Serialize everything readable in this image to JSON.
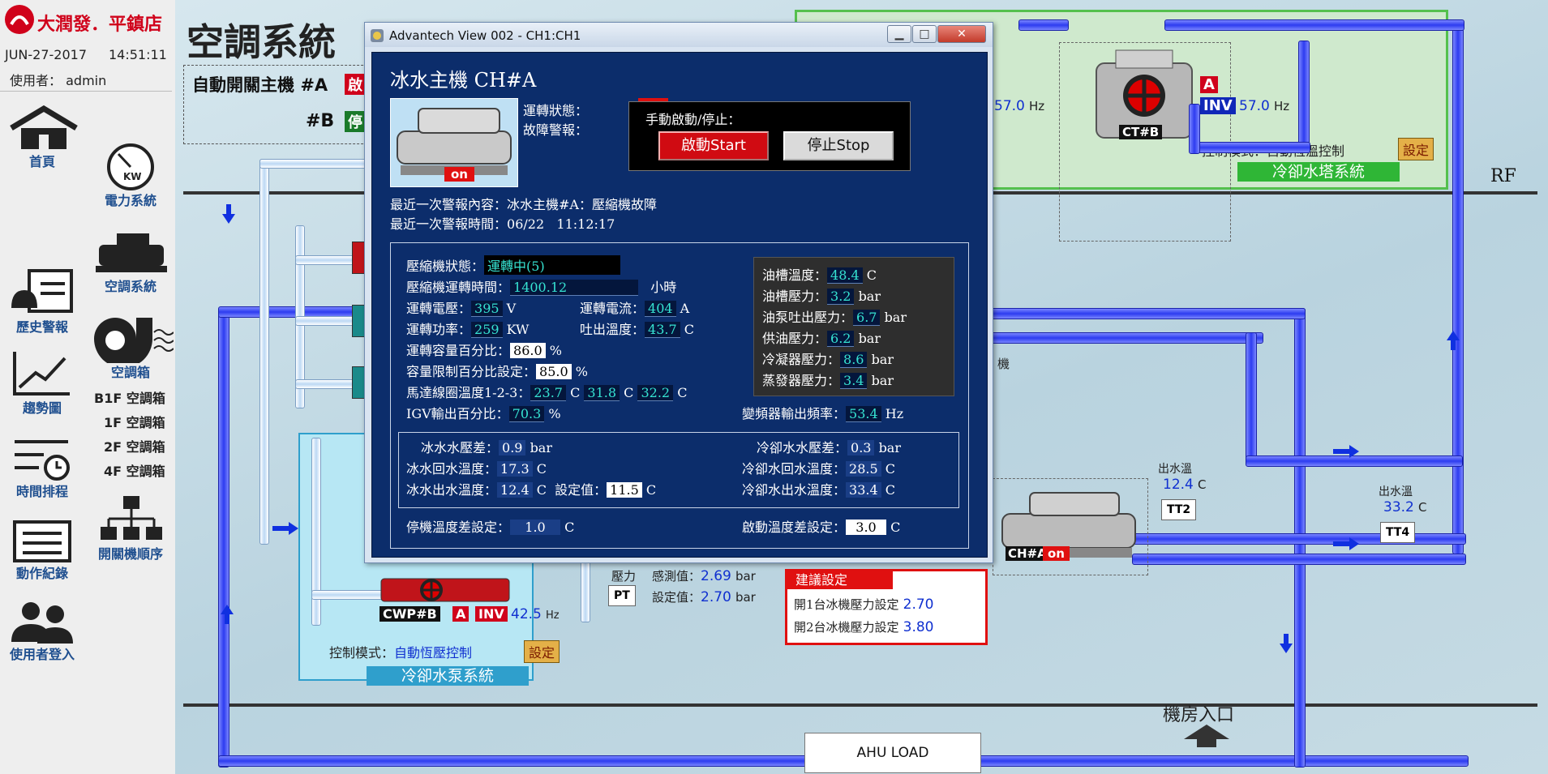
{
  "brand": {
    "name": "大潤發．平鎮店"
  },
  "header": {
    "date": "JUN-27-2017",
    "time": "14:51:11",
    "user_label": "使用者：",
    "user": "admin",
    "page_title": "空調系統"
  },
  "nav_left": [
    {
      "label": "首頁",
      "icon": "home-icon"
    },
    {
      "label": "歷史警報",
      "icon": "alarm-history-icon"
    },
    {
      "label": "趨勢圖",
      "icon": "trend-chart-icon"
    },
    {
      "label": "時間排程",
      "icon": "schedule-icon"
    },
    {
      "label": "動作紀錄",
      "icon": "action-log-icon"
    },
    {
      "label": "使用者登入",
      "icon": "users-icon"
    }
  ],
  "nav_right": [
    {
      "label": "電力系統",
      "icon": "power-meter-icon"
    },
    {
      "label": "空調系統",
      "icon": "chiller-icon"
    },
    {
      "label": "空調箱",
      "icon": "ahu-fan-icon"
    }
  ],
  "ahu_sub": [
    "B1F 空調箱",
    "1F 空調箱",
    "2F 空調箱",
    "4F 空調箱"
  ],
  "auto_switch": {
    "label": "自動開關主機",
    "a": "#A",
    "b": "#B",
    "a_btn": "啟",
    "b_btn": "停"
  },
  "cooling_tower": {
    "unit": "CT#B",
    "tag_a": "A",
    "tag_inv": "INV",
    "freq": "57.0",
    "freq_left": "57.0",
    "hz": "Hz",
    "mode_label": "控制模式：自動恆溫控制",
    "set_btn": "設定",
    "system_label": "冷卻水塔系統"
  },
  "rf_label": "RF",
  "pump": {
    "unit": "CWP#B",
    "tag_a": "A",
    "tag_inv": "INV",
    "freq": "42.5",
    "hz": "Hz",
    "mode_label": "控制模式：",
    "mode_value": "自動恆壓控制",
    "set_btn": "設定",
    "system_label": "冷卻水泵系統"
  },
  "pressure": {
    "title": "壓力",
    "sense_label": "感測值：",
    "sense_value": "2.69",
    "set_label": "設定值：",
    "set_value": "2.70",
    "unit": "bar",
    "tag": "PT"
  },
  "suggest": {
    "title": "建議設定",
    "row1_label": "開1台冰機壓力設定",
    "row1_value": "2.70",
    "row2_label": "開2台冰機壓力設定",
    "row2_value": "3.80"
  },
  "chiller_main": {
    "unit": "CH#A",
    "state": "on",
    "side_label": "機"
  },
  "outlet1": {
    "label": "出水溫",
    "value": "12.4",
    "unit": "C",
    "tag": "TT2"
  },
  "outlet2": {
    "label": "出水溫",
    "value": "33.2",
    "unit": "C",
    "tag": "TT4"
  },
  "machine_room_entry": "機房入口",
  "ahu_load": "AHU LOAD",
  "dialog": {
    "title": "Advantech View 002 - CH1:CH1",
    "heading": "冰水主機  CH#A",
    "image_badge": "on",
    "run_status_label": "運轉狀態：",
    "run_status": "on",
    "fault_label": "故障警報：",
    "fault_status": "-",
    "manual_label": "手動啟動/停止：",
    "start_btn": "啟動Start",
    "stop_btn": "停止Stop",
    "last_alarm_label": "最近一次警報內容：",
    "last_alarm": "冰水主機#A：壓縮機故障",
    "last_alarm_time_label": "最近一次警報時間：",
    "last_alarm_date": "06/22",
    "last_alarm_time": "11:12:17",
    "compressor_status_label": "壓縮機狀態：",
    "compressor_status": "運轉中(5)",
    "run_hours_label": "壓縮機運轉時間：",
    "run_hours": "1400.12",
    "run_hours_unit": "小時",
    "voltage_label": "運轉電壓：",
    "voltage": "395",
    "voltage_unit": "V",
    "current_label": "運轉電流：",
    "current": "404",
    "current_unit": "A",
    "power_label": "運轉功率：",
    "power": "259",
    "power_unit": "KW",
    "discharge_label": "吐出溫度：",
    "discharge": "43.7",
    "discharge_unit": "C",
    "capacity_label": "運轉容量百分比：",
    "capacity": "86.0",
    "pct": "%",
    "cap_limit_label": "容量限制百分比設定：",
    "cap_limit": "85.0",
    "motor_label": "馬達線圈溫度1-2-3：",
    "motor1": "23.7",
    "motor2": "31.8",
    "motor3": "32.2",
    "c": "C",
    "igv_label": "IGV輸出百分比：",
    "igv": "70.3",
    "vfd_label": "變頻器輸出頻率：",
    "vfd": "53.4",
    "hz": "Hz",
    "bar": "bar",
    "oil_temp_label": "油槽溫度：",
    "oil_temp": "48.4",
    "oil_press_label": "油槽壓力：",
    "oil_press": "3.2",
    "oil_pump_label": "油泵吐出壓力：",
    "oil_pump": "6.7",
    "oil_supply_label": "供油壓力：",
    "oil_supply": "6.2",
    "cond_label": "冷凝器壓力：",
    "cond": "8.6",
    "evap_label": "蒸發器壓力：",
    "evap": "3.4",
    "chw_dp_label": "冰水水壓差：",
    "chw_dp": "0.9",
    "cw_dp_label": "冷卻水水壓差：",
    "cw_dp": "0.3",
    "chw_return_label": "冰水回水溫度：",
    "chw_return": "17.3",
    "cw_return_label": "冷卻水回水溫度：",
    "cw_return": "28.5",
    "chw_supply_label": "冰水出水溫度：",
    "chw_supply": "12.4",
    "setpoint_label": "設定值：",
    "setpoint": "11.5",
    "cw_supply_label": "冷卻水出水溫度：",
    "cw_supply": "33.4",
    "stop_diff_label": "停機溫度差設定：",
    "stop_diff": "1.0",
    "start_diff_label": "啟動溫度差設定：",
    "start_diff": "3.0"
  }
}
